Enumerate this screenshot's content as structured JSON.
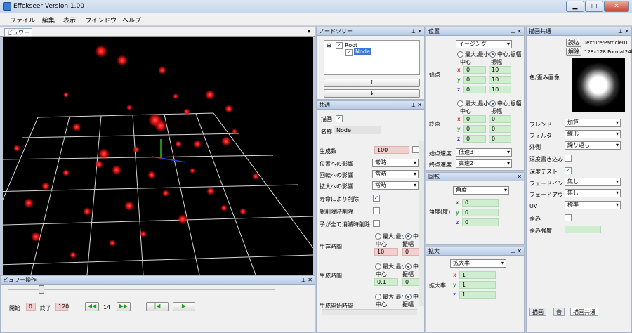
{
  "title": "Effekseer Version 1.00",
  "menu": [
    "ファイル",
    "編集",
    "表示",
    "ウインドウ",
    "ヘルプ"
  ],
  "viewer": {
    "tab": "ビュワー"
  },
  "viewer_ops": {
    "title": "ビュワー操作",
    "start_label": "開始",
    "start": "0",
    "end_label": "終了",
    "end": "120",
    "frame": "14"
  },
  "node_tree": {
    "title": "ノードツリー",
    "root": "Root",
    "node": "Node",
    "up": "↑",
    "down": "↓"
  },
  "common": {
    "title": "共通",
    "draw": "描画",
    "name_label": "名称",
    "name": "Node",
    "spawn": "生成数",
    "spawn_val": "100",
    "pos_inf": "位置への影響",
    "rot_inf": "回転への影響",
    "scale_inf": "拡大への影響",
    "always": "常時",
    "life_del": "寿命により削除",
    "parent_del": "親削除時削除",
    "child_del": "子が全て消滅時削除",
    "life": "生存時間",
    "gen_time": "生成時間",
    "gen_start": "生成開始時間",
    "minmax": "最大,最小",
    "centeramp": "中",
    "center": "中心",
    "amp": "振幅",
    "life_c": "10",
    "life_a": "0",
    "gen_c": "0.1",
    "gen_a": "0"
  },
  "position": {
    "title": "位置",
    "mode": "イージング",
    "start": "始点",
    "end": "終点",
    "minmax": "最大,最小",
    "centeramp": "中心,振幅",
    "center": "中心",
    "amp": "振幅",
    "s_x": "0",
    "s_y": "0",
    "s_z": "0",
    "s_xa": "10",
    "s_ya": "10",
    "s_za": "10",
    "e_x": "0",
    "e_y": "0",
    "e_z": "0",
    "e_xa": "0",
    "e_ya": "0",
    "e_za": "0",
    "sp_label": "始点速度",
    "sp": "低速3",
    "ep_label": "終点速度",
    "ep": "高速2"
  },
  "rotation": {
    "title": "回転",
    "mode": "角度",
    "label": "角度(度)",
    "x": "0",
    "y": "0",
    "z": "0"
  },
  "scale": {
    "title": "拡大",
    "mode": "拡大率",
    "label": "拡大率",
    "x": "1",
    "y": "1",
    "z": "1"
  },
  "render": {
    "title": "描画共通",
    "read": "読込",
    "release": "解除",
    "texture": "Texture/Particle01",
    "texinfo": "128x128 Format24b",
    "color_img": "色/歪み画像",
    "blend": "ブレンド",
    "blend_v": "加算",
    "filter": "フィルタ",
    "filter_v": "線形",
    "wrap": "外側",
    "wrap_v": "繰り返し",
    "depth_write": "深度書き込み",
    "depth_test": "深度テスト",
    "fadein": "フェードイン",
    "fadein_v": "無し",
    "fadeout": "フェードアウト",
    "fadeout_v": "無し",
    "uv": "UV",
    "uv_v": "標準",
    "distort": "歪み",
    "distort_str": "歪み強度",
    "tabs": [
      "描画",
      "音",
      "描画共通"
    ]
  }
}
